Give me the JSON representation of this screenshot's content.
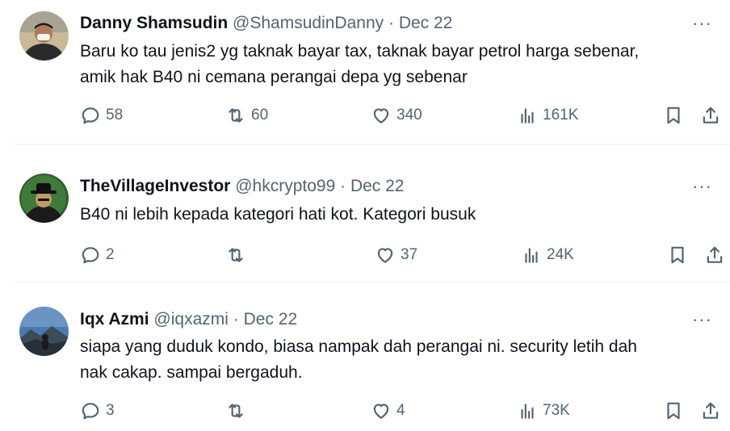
{
  "tweets": [
    {
      "name": "Danny Shamsudin",
      "handle": "@ShamsudinDanny",
      "sep": "·",
      "date": "Dec 22",
      "text_lines": [
        "Baru ko tau jenis2 yg taknak bayar tax, taknak bayar petrol harga sebenar,",
        "amik hak B40 ni cemana perangai depa yg sebenar"
      ],
      "replies": "58",
      "retweets": "60",
      "likes": "340",
      "views": "161K"
    },
    {
      "name": "TheVillageInvestor",
      "handle": "@hkcrypto99",
      "sep": "·",
      "date": "Dec 22",
      "text_lines": [
        "B40 ni lebih kepada kategori hati kot. Kategori busuk"
      ],
      "replies": "2",
      "retweets": "",
      "likes": "37",
      "views": "24K"
    },
    {
      "name": "Iqx Azmi",
      "handle": "@iqxazmi",
      "sep": "·",
      "date": "Dec 22",
      "text_lines": [
        "siapa yang duduk kondo, biasa nampak dah perangai ni. security letih dah",
        "nak cakap. sampai bergaduh."
      ],
      "replies": "3",
      "retweets": "",
      "likes": "4",
      "views": "73K"
    }
  ],
  "more_label": "···",
  "icons": {
    "reply": "reply-icon",
    "retweet": "retweet-icon",
    "like": "heart-icon",
    "views": "views-chart-icon",
    "bookmark": "bookmark-icon",
    "share": "share-icon"
  },
  "colors": {
    "text": "#0f1419",
    "muted": "#536471",
    "divider": "#eff3f4"
  }
}
